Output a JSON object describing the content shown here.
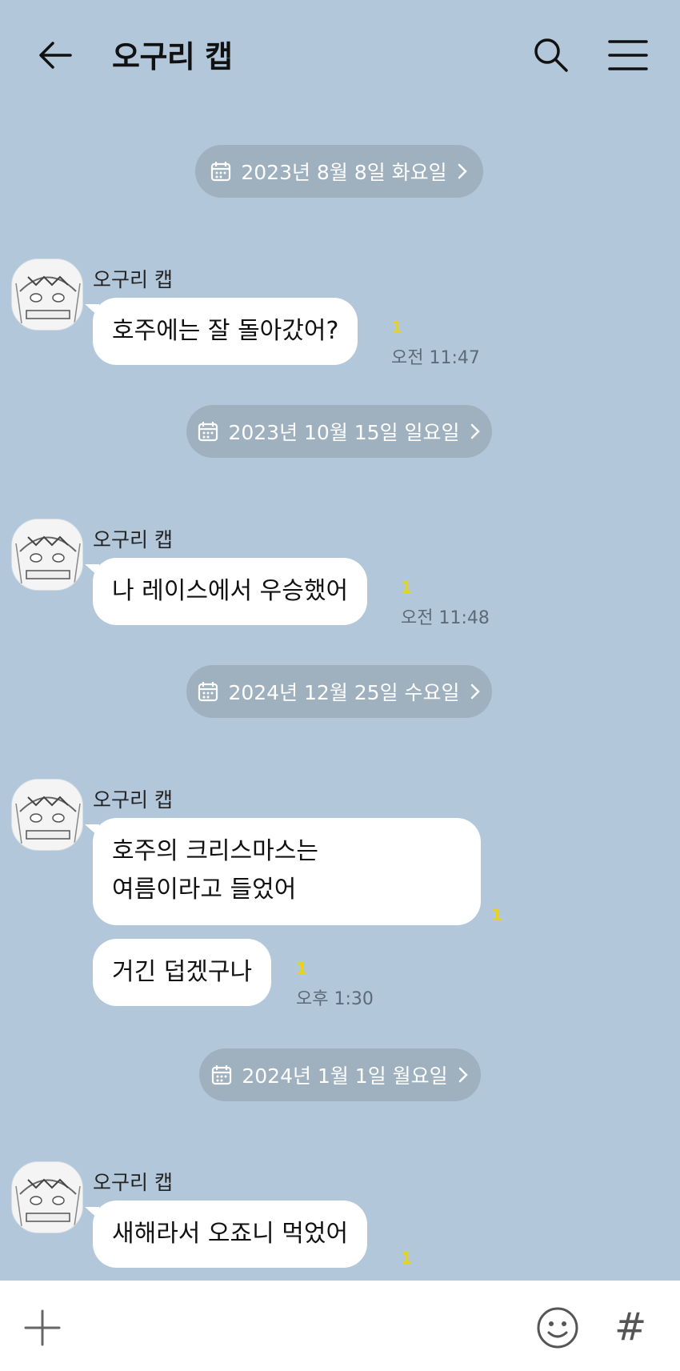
{
  "header": {
    "title": "오구리 캡",
    "back_icon": "arrow-left-icon",
    "search_icon": "search-icon",
    "menu_icon": "hamburger-menu-icon"
  },
  "dates": [
    "2023년 8월 8일 화요일",
    "2023년 10월 15일 일요일",
    "2024년 12월 25일 수요일",
    "2024년 1월 1일 월요일"
  ],
  "messages": [
    {
      "sender": "오구리 캡",
      "text": "호주에는 잘 돌아갔어?",
      "unread": "1",
      "time": "오전 11:47"
    },
    {
      "sender": "오구리 캡",
      "text": "나 레이스에서 우승했어",
      "unread": "1",
      "time": "오전 11:48"
    },
    {
      "sender": "오구리 캡",
      "text_line1": "호주의 크리스마스는",
      "text_line2": "여름이라고 들었어",
      "unread": "1"
    },
    {
      "text": "거긴 덥겠구나",
      "unread": "1",
      "time": "오후 1:30"
    },
    {
      "sender": "오구리 캡",
      "text": "새해라서 오죠니 먹었어",
      "unread": "1"
    }
  ],
  "input_bar": {
    "plus_icon": "plus-icon",
    "emoji_icon": "emoji-icon",
    "hash_label": "#"
  },
  "colors": {
    "background": "#b2c7da",
    "date_pill": "#9fb0bf",
    "unread": "#e8d21c"
  }
}
